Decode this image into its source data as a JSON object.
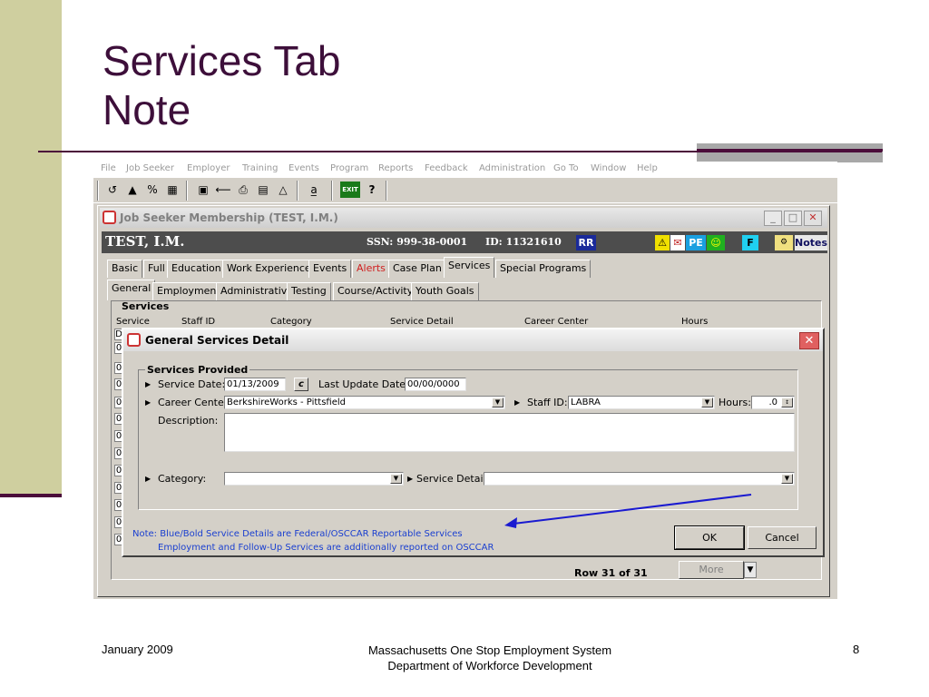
{
  "slide": {
    "title_line1": "Services Tab",
    "title_line2": "Note",
    "footer_left": "January 2009",
    "footer_center_line1": "Massachusetts One Stop Employment System",
    "footer_center_line2": "Department of Workforce Development",
    "footer_right": "8"
  },
  "menubar": {
    "items": [
      "File",
      "Job Seeker",
      "Employer",
      "Training",
      "Events",
      "Program",
      "Reports",
      "Feedback",
      "Administration",
      "Go To",
      "Window",
      "Help"
    ]
  },
  "toolbar": {
    "exit_label": "EXIT",
    "help_glyph": "?"
  },
  "window": {
    "title": "Job Seeker Membership (TEST, I.M.)",
    "minimize": "_",
    "maximize": "□",
    "close": "✕"
  },
  "banner": {
    "name": "TEST, I.M.",
    "ssn": "SSN:  999-38-0001",
    "id": "ID: 11321610",
    "badges": [
      "RR",
      "PE",
      "F",
      "Notes"
    ]
  },
  "tabs": [
    "Basic",
    "Full",
    "Education",
    "Work Experience",
    "Events",
    "Alerts",
    "Case Plan",
    "Services",
    "Special Programs"
  ],
  "sub_tabs": [
    "General",
    "Employment",
    "Administrative",
    "Testing",
    "Course/Activity",
    "Youth Goals"
  ],
  "services": {
    "group_label": "Services",
    "columns": [
      "Service",
      "Staff ID",
      "Category",
      "Service Detail",
      "Career Center",
      "Hours"
    ],
    "row_markers": [
      "D",
      "0",
      "0",
      "0",
      "0",
      "0",
      "0",
      "0",
      "0",
      "0",
      "0",
      "0",
      "0",
      "0",
      "0",
      "0"
    ],
    "row_count": "Row 31 of 31",
    "more_label": "More"
  },
  "dialog": {
    "title": "General Services Detail",
    "close": "✕",
    "group_label": "Services Provided",
    "service_date_label": "Service Date:",
    "service_date_value": "01/13/2009",
    "calendar_btn": "c",
    "last_update_label": "Last Update Date:",
    "last_update_value": "00/00/0000",
    "career_center_label": "Career Center:",
    "career_center_value": "BerkshireWorks - Pittsfield",
    "staff_id_label": "Staff ID:",
    "staff_id_value": "LABRA",
    "hours_label": "Hours:",
    "hours_value": ".0",
    "description_label": "Description:",
    "description_value": "",
    "category_label": "Category:",
    "category_value": "",
    "service_detail_label": "Service Detail:",
    "service_detail_value": "",
    "note_line1": "Note: Blue/Bold Service Details are Federal/OSCCAR Reportable Services",
    "note_line2": "Employment and Follow-Up Services are additionally reported on OSCCAR",
    "ok_label": "OK",
    "cancel_label": "Cancel"
  },
  "colors": {
    "title": "#3d0f3a",
    "left_bar": "#cfcf9f",
    "rule": "#4b0d3a",
    "note_text": "#1a3fd0",
    "annotation_arrow": "#1a1ad0"
  }
}
